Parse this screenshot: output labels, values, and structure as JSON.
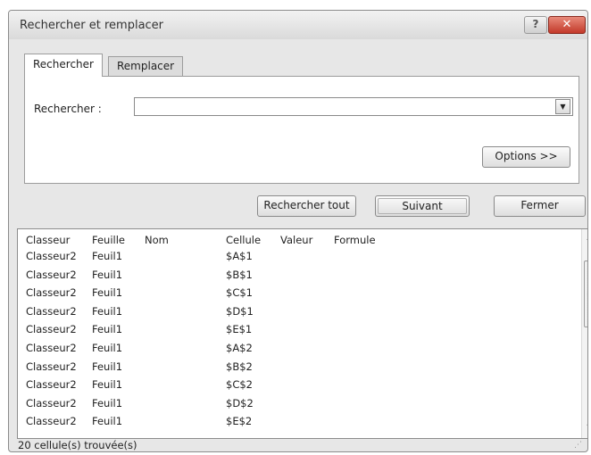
{
  "dialog": {
    "title": "Rechercher et remplacer",
    "help_label": "?",
    "close_label": "✕"
  },
  "tabs": [
    {
      "label": "Rechercher",
      "active": true
    },
    {
      "label": "Remplacer",
      "active": false
    }
  ],
  "search": {
    "label": "Rechercher :",
    "value": "",
    "dropdown_icon": "▼"
  },
  "buttons": {
    "options": "Options >>",
    "find_all": "Rechercher tout",
    "next": "Suivant",
    "close": "Fermer"
  },
  "results": {
    "columns": [
      "Classeur",
      "Feuille",
      "Nom",
      "Cellule",
      "Valeur",
      "Formule"
    ],
    "rows": [
      [
        "Classeur2",
        "Feuil1",
        "",
        "$A$1",
        "",
        ""
      ],
      [
        "Classeur2",
        "Feuil1",
        "",
        "$B$1",
        "",
        ""
      ],
      [
        "Classeur2",
        "Feuil1",
        "",
        "$C$1",
        "",
        ""
      ],
      [
        "Classeur2",
        "Feuil1",
        "",
        "$D$1",
        "",
        ""
      ],
      [
        "Classeur2",
        "Feuil1",
        "",
        "$E$1",
        "",
        ""
      ],
      [
        "Classeur2",
        "Feuil1",
        "",
        "$A$2",
        "",
        ""
      ],
      [
        "Classeur2",
        "Feuil1",
        "",
        "$B$2",
        "",
        ""
      ],
      [
        "Classeur2",
        "Feuil1",
        "",
        "$C$2",
        "",
        ""
      ],
      [
        "Classeur2",
        "Feuil1",
        "",
        "$D$2",
        "",
        ""
      ],
      [
        "Classeur2",
        "Feuil1",
        "",
        "$E$2",
        "",
        ""
      ]
    ]
  },
  "status": {
    "text": "20 cellule(s) trouvée(s)"
  },
  "icons": {
    "scroll_up": "▲",
    "scroll_down": "▼",
    "thumb_grip": "≡",
    "resize_grip": "⋰"
  }
}
